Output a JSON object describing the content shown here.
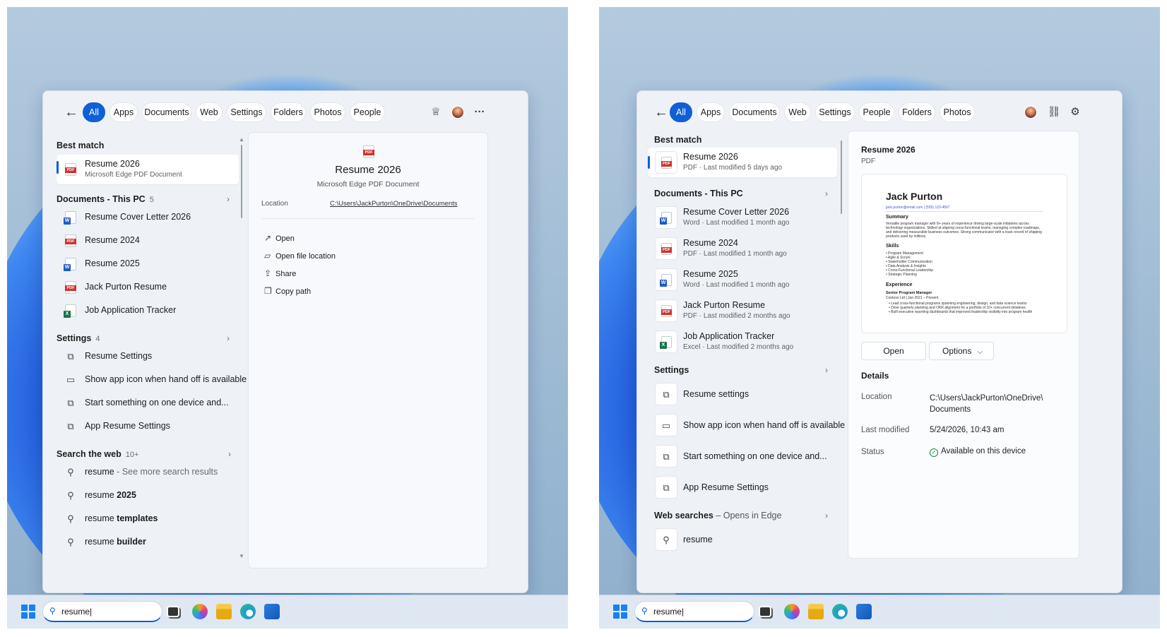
{
  "left": {
    "filters": [
      "All",
      "Apps",
      "Documents",
      "Web",
      "Settings",
      "Folders",
      "Photos",
      "People"
    ],
    "best_match_header": "Best match",
    "best_match": {
      "title": "Resume 2026",
      "subtitle": "Microsoft Edge PDF Document"
    },
    "documents_header": "Documents - This PC",
    "documents_count": "5",
    "documents": [
      {
        "label": "Resume Cover Letter 2026",
        "icon": "word-file-icon"
      },
      {
        "label": "Resume 2024",
        "icon": "pdf-file-icon"
      },
      {
        "label": "Resume 2025",
        "icon": "word-file-icon"
      },
      {
        "label": "Jack Purton Resume",
        "icon": "pdf-file-icon"
      },
      {
        "label": "Job Application Tracker",
        "icon": "excel-file-icon"
      }
    ],
    "settings_header": "Settings",
    "settings_count": "4",
    "settings": [
      {
        "label": "Resume Settings"
      },
      {
        "label": "Show app icon when hand off is available"
      },
      {
        "label": "Start something on one device and..."
      },
      {
        "label": "App Resume Settings"
      }
    ],
    "web_header": "Search the web",
    "web_count": "10+",
    "web": [
      {
        "q": "resume",
        "bold": "",
        "suffix": " - See more search results"
      },
      {
        "q": "resume ",
        "bold": "2025",
        "suffix": ""
      },
      {
        "q": "resume ",
        "bold": "templates",
        "suffix": ""
      },
      {
        "q": "resume ",
        "bold": "builder",
        "suffix": ""
      }
    ],
    "preview": {
      "title": "Resume 2026",
      "subtitle": "Microsoft Edge PDF Document",
      "location_label": "Location",
      "location_value": "C:\\Users\\JackPurton\\OneDrive\\Documents",
      "actions": [
        "Open",
        "Open file location",
        "Share",
        "Copy path"
      ]
    },
    "taskbar_query": "resume|"
  },
  "right": {
    "filters": [
      "All",
      "Apps",
      "Documents",
      "Web",
      "Settings",
      "People",
      "Folders",
      "Photos"
    ],
    "best_match_header": "Best match",
    "best_match": {
      "title": "Resume 2026",
      "subtitle": "PDF · Last modified 5 days ago"
    },
    "documents_header": "Documents - This PC",
    "documents": [
      {
        "title": "Resume Cover Letter 2026",
        "subtitle": "Word · Last modified 1 month ago",
        "icon": "word-file-icon"
      },
      {
        "title": "Resume 2024",
        "subtitle": "PDF · Last modified 1 month ago",
        "icon": "pdf-file-icon"
      },
      {
        "title": "Resume 2025",
        "subtitle": "Word · Last modified 1 month ago",
        "icon": "word-file-icon"
      },
      {
        "title": "Jack Purton Resume",
        "subtitle": "PDF · Last modified 2 months ago",
        "icon": "pdf-file-icon"
      },
      {
        "title": "Job Application Tracker",
        "subtitle": "Excel · Last modified 2 months ago",
        "icon": "excel-file-icon"
      }
    ],
    "settings_header": "Settings",
    "settings": [
      {
        "label": "Resume settings"
      },
      {
        "label": "Show app icon when hand off is available"
      },
      {
        "label": "Start something on one device and..."
      },
      {
        "label": "App Resume Settings"
      }
    ],
    "web_header": "Web searches",
    "web_sub": " – Opens in Edge",
    "web": [
      {
        "label": "resume"
      }
    ],
    "preview": {
      "title": "Resume 2026",
      "type": "PDF",
      "doc_name": "Jack Purton",
      "doc_contact": "jack.purton@email.com | (555) 123-4567",
      "doc_summary_h": "Summary",
      "doc_summary": "Versatile program manager with 8+ years of experience driving large-scale initiatives across technology organizations. Skilled at aligning cross-functional teams, managing complex roadmaps, and delivering measurable business outcomes. Strong communicator with a track record of shipping products used by millions.",
      "doc_skills_h": "Skills",
      "doc_skills": [
        "• Program Management",
        "• Agile & Scrum",
        "• Stakeholder Communication",
        "• Data Analysis & Insights",
        "• Cross-Functional Leadership",
        "• Strategic Planning"
      ],
      "doc_exp_h": "Experience",
      "doc_role": "Senior Program Manager",
      "doc_company": "Contoso Ltd | Jan 2021 – Present",
      "doc_bullets": [
        "• Lead cross-functional programs spanning engineering, design, and data science teams",
        "• Drive quarterly planning and OKR alignment for a portfolio of 10+ concurrent initiatives",
        "• Built executive reporting dashboards that improved leadership visibility into program health"
      ],
      "open_label": "Open",
      "options_label": "Options",
      "details_header": "Details",
      "location_label": "Location",
      "location_value": "C:\\Users\\JackPurton\\OneDrive\\ Documents",
      "modified_label": "Last modified",
      "modified_value": "5/24/2026, 10:43 am",
      "status_label": "Status",
      "status_value": "Available on this device"
    },
    "taskbar_query": "resume|"
  }
}
